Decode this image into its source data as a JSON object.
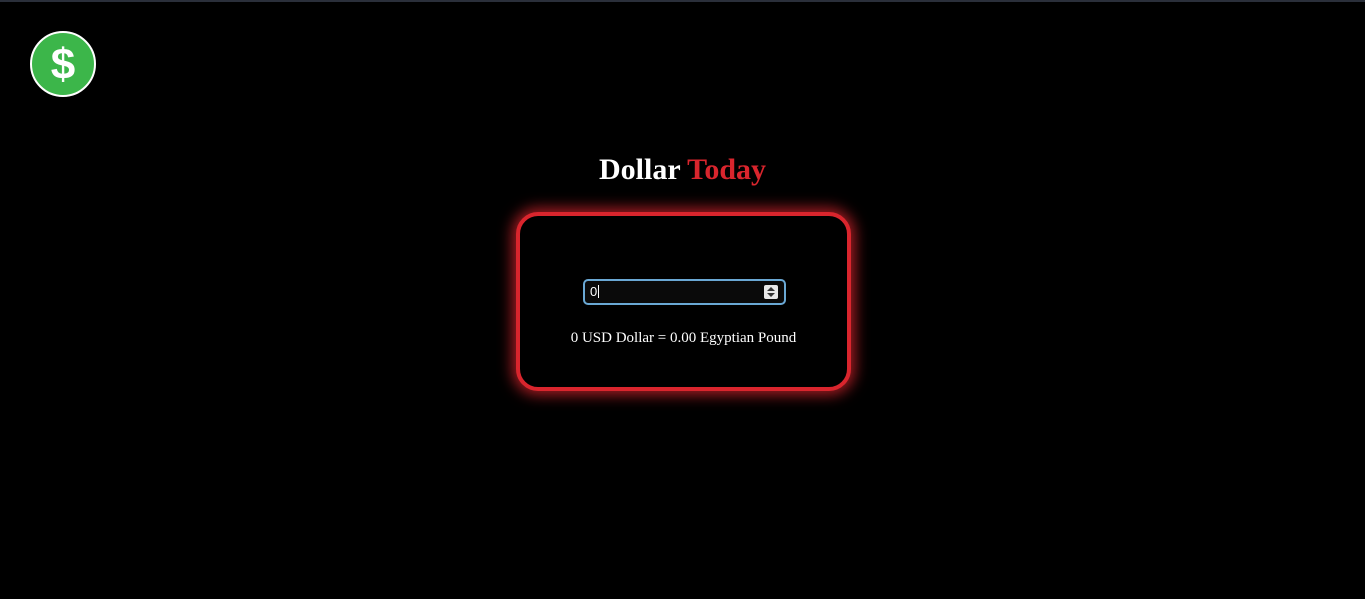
{
  "logo": {
    "icon": "dollar-icon",
    "color": "#3cb64a"
  },
  "header": {
    "title_main": "Dollar",
    "title_accent": "Today",
    "accent_color": "#d9252d"
  },
  "converter": {
    "amount_value": "0",
    "result_text": "0 USD Dollar = 0.00 Egyptian Pound"
  }
}
